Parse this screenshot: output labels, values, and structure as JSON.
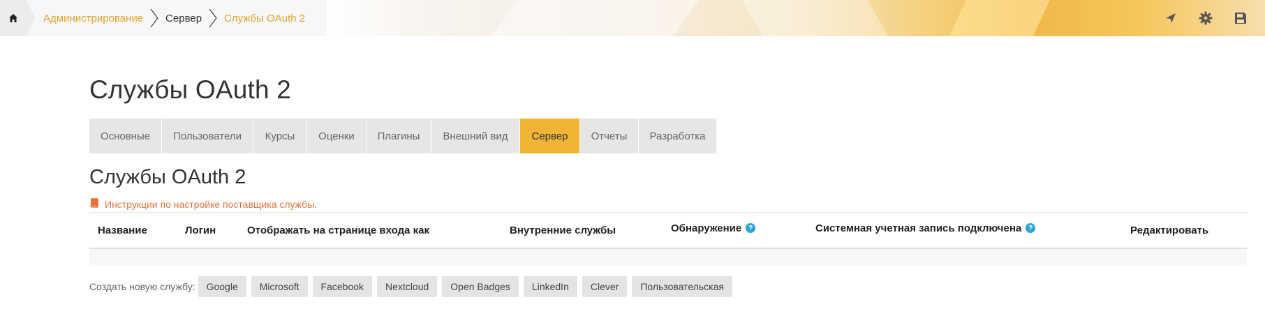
{
  "breadcrumb": {
    "items": [
      {
        "label": "Администрирование",
        "kind": "link"
      },
      {
        "label": "Сервер",
        "kind": "current"
      },
      {
        "label": "Службы OAuth 2",
        "kind": "link"
      }
    ]
  },
  "header_icons": [
    "navigate-icon",
    "gear-icon",
    "save-icon"
  ],
  "page": {
    "title": "Службы OAuth 2"
  },
  "tabs": [
    {
      "label": "Основные",
      "active": false
    },
    {
      "label": "Пользователи",
      "active": false
    },
    {
      "label": "Курсы",
      "active": false
    },
    {
      "label": "Оценки",
      "active": false
    },
    {
      "label": "Плагины",
      "active": false
    },
    {
      "label": "Внешний вид",
      "active": false
    },
    {
      "label": "Сервер",
      "active": true
    },
    {
      "label": "Отчеты",
      "active": false
    },
    {
      "label": "Разработка",
      "active": false
    }
  ],
  "section": {
    "title": "Службы OAuth 2",
    "instructions_link": "Инструкции по настройке поставщика службы."
  },
  "table": {
    "headers": [
      "Название",
      "Логин",
      "Отображать на странице входа как",
      "Внутренние службы",
      "Обнаружение",
      "Системная учетная запись подключена",
      "Редактировать"
    ],
    "rows": []
  },
  "create": {
    "label": "Создать новую службу:",
    "buttons": [
      "Google",
      "Microsoft",
      "Facebook",
      "Nextcloud",
      "Open Badges",
      "LinkedIn",
      "Clever",
      "Пользовательская"
    ]
  },
  "colors": {
    "accent": "#f0b534",
    "link": "#e2a32a",
    "instructions": "#e5733a",
    "help": "#2ba4d6"
  }
}
